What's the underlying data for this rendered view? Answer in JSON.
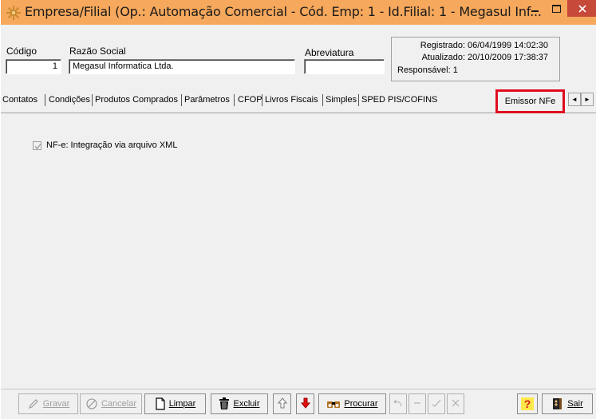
{
  "window": {
    "title": "Empresa/Filial (Op.: Automação Comercial - Cód. Emp: 1 - Id.Filial: 1 - Megasul Inf...",
    "colors": {
      "titlebar": "#f6a85c",
      "close": "#c7493a",
      "highlight": "#e00b1e"
    }
  },
  "header": {
    "codigo_label": "Código",
    "codigo_value": "1",
    "razao_label": "Razão Social",
    "razao_value": "Megasul Informatica Ltda.",
    "abreviatura_label": "Abreviatura",
    "abreviatura_value": ""
  },
  "info": {
    "registrado": "Registrado: 06/04/1999 14:02:30",
    "atualizado": "Atualizado: 20/10/2009 17:38:37",
    "responsavel": "Responsável: 1"
  },
  "tabs": [
    "Contatos",
    "Condições",
    "Produtos Comprados",
    "Parâmetros",
    "CFOP",
    "Livros Fiscais",
    "Simples",
    "SPED PIS/COFINS",
    "Emissor NFe"
  ],
  "tab_arrows": {
    "left": "◄",
    "right": "►"
  },
  "content": {
    "checkbox_label": "NF-e: Integração via arquivo XML",
    "checkbox_checked": true
  },
  "toolbar": {
    "gravar": "Gravar",
    "cancelar": "Cancelar",
    "limpar": "Limpar",
    "excluir": "Excluir",
    "procurar": "Procurar",
    "help": "?",
    "sair": "Sair"
  }
}
